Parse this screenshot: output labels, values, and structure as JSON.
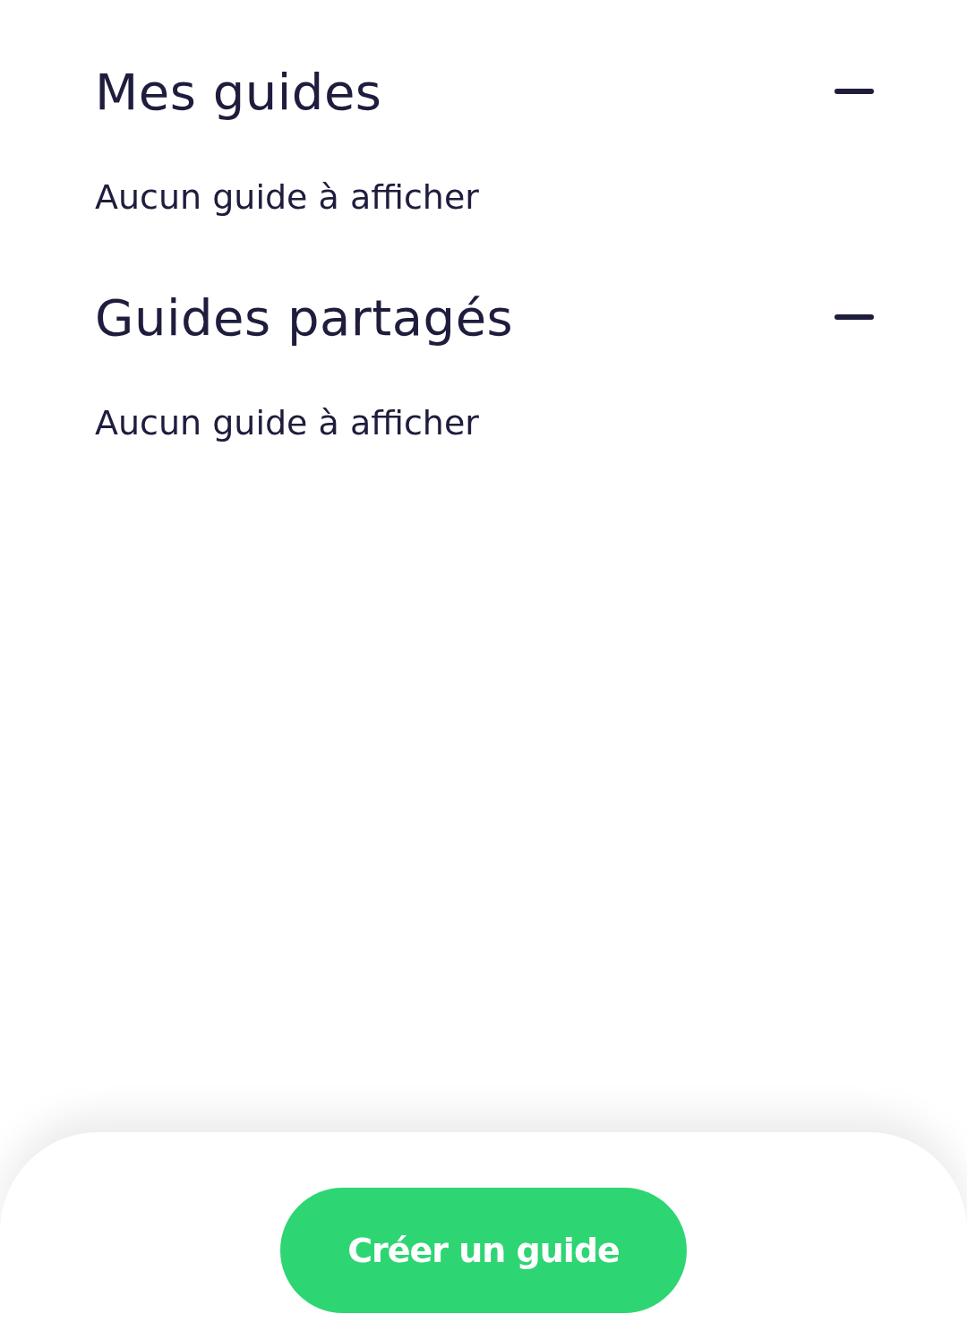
{
  "sections": [
    {
      "title": "Mes guides",
      "expanded": true,
      "empty_text": "Aucun guide à afficher"
    },
    {
      "title": "Guides partagés",
      "expanded": true,
      "empty_text": "Aucun guide à afficher"
    }
  ],
  "bottom_bar": {
    "button": "Créer un guide"
  }
}
